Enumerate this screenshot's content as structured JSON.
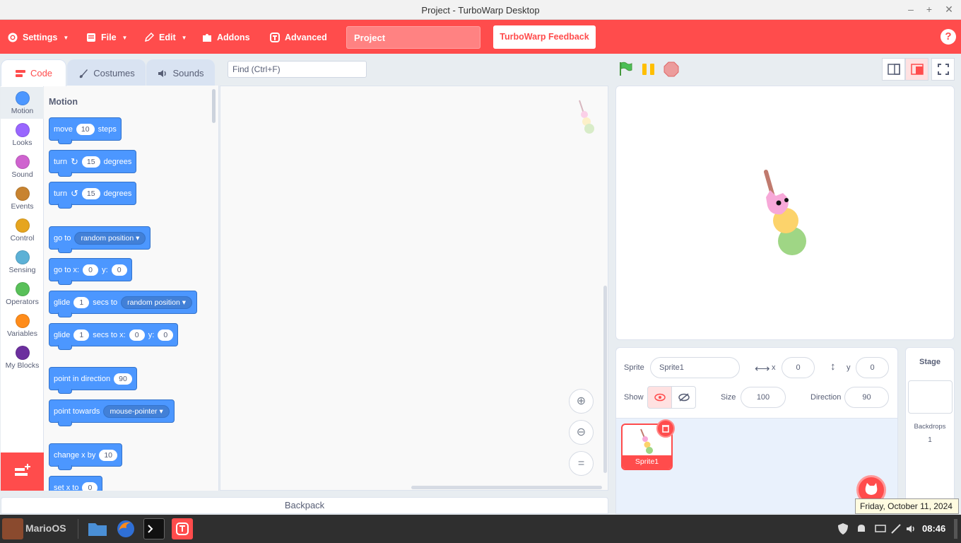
{
  "window": {
    "title": "Project - TurboWarp Desktop"
  },
  "menu": {
    "settings": "Settings",
    "file": "File",
    "edit": "Edit",
    "addons": "Addons",
    "advanced": "Advanced",
    "project_title": "Project",
    "feedback": "TurboWarp Feedback",
    "help": "?"
  },
  "tabs": {
    "code": "Code",
    "costumes": "Costumes",
    "sounds": "Sounds"
  },
  "find": {
    "placeholder": "Find (Ctrl+F)"
  },
  "categories": [
    {
      "label": "Motion",
      "color": "#4c97ff"
    },
    {
      "label": "Looks",
      "color": "#9966ff"
    },
    {
      "label": "Sound",
      "color": "#cf63cf"
    },
    {
      "label": "Events",
      "color": "#ffbf00"
    },
    {
      "label": "Control",
      "color": "#ffab19"
    },
    {
      "label": "Sensing",
      "color": "#5cb1d6"
    },
    {
      "label": "Operators",
      "color": "#59c059"
    },
    {
      "label": "Variables",
      "color": "#ff8c1a"
    },
    {
      "label": "My Blocks",
      "color": "#ff6680"
    }
  ],
  "palette": {
    "title": "Motion",
    "move": {
      "a": "move",
      "n": "10",
      "b": "steps"
    },
    "turn_cw": {
      "a": "turn",
      "n": "15",
      "b": "degrees"
    },
    "turn_ccw": {
      "a": "turn",
      "n": "15",
      "b": "degrees"
    },
    "goto": {
      "a": "go to",
      "dd": "random position"
    },
    "goto_xy": {
      "a": "go to x:",
      "x": "0",
      "yl": "y:",
      "y": "0"
    },
    "glide": {
      "a": "glide",
      "n": "1",
      "b": "secs to",
      "dd": "random position"
    },
    "glide_xy": {
      "a": "glide",
      "n": "1",
      "b": "secs to x:",
      "x": "0",
      "yl": "y:",
      "y": "0"
    },
    "point_dir": {
      "a": "point in direction",
      "n": "90"
    },
    "point_towards": {
      "a": "point towards",
      "dd": "mouse-pointer"
    },
    "change_x": {
      "a": "change x by",
      "n": "10"
    },
    "set_x": {
      "a": "set x to",
      "n": "0"
    }
  },
  "backpack": "Backpack",
  "sprite_info": {
    "sprite_label": "Sprite",
    "sprite_name": "Sprite1",
    "x_label": "x",
    "x": "0",
    "y_label": "y",
    "y": "0",
    "show_label": "Show",
    "size_label": "Size",
    "size": "100",
    "direction_label": "Direction",
    "direction": "90"
  },
  "sprites": [
    {
      "name": "Sprite1"
    }
  ],
  "stage_panel": {
    "title": "Stage",
    "backdrops_label": "Backdrops",
    "backdrops_count": "1"
  },
  "taskbar": {
    "os": "MarioOS",
    "clock": "08:46",
    "date_tooltip": "Friday, October 11, 2024"
  },
  "colors": {
    "accent": "#ff4c4c",
    "motion": "#4c97ff"
  }
}
